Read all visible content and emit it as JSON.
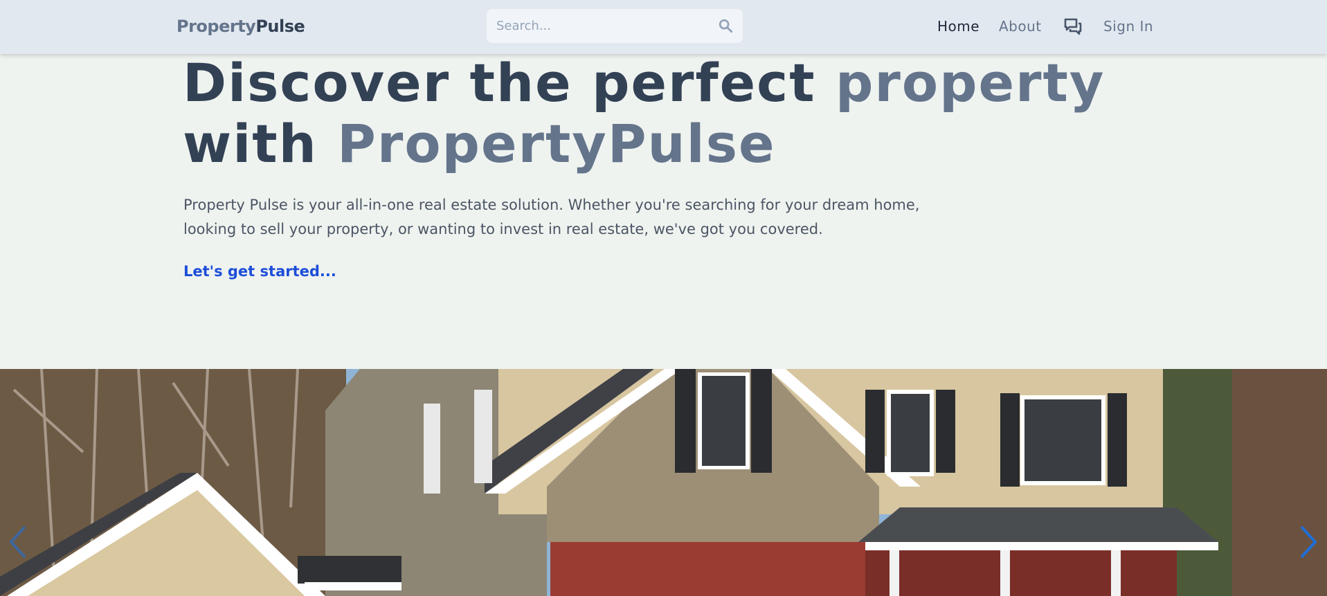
{
  "header": {
    "brand_part1": "Property",
    "brand_part2": "Pulse",
    "search_placeholder": "Search...",
    "nav": {
      "home": "Home",
      "about": "About",
      "sign_in": "Sign In"
    },
    "icons": {
      "search": "search-icon",
      "messages": "chat-icon"
    }
  },
  "hero": {
    "title_part1": "Discover the perfect ",
    "title_part2": "property",
    "title_part3": "with ",
    "title_part4": "PropertyPulse",
    "description": "Property Pulse is your all-in-one real estate solution. Whether you're searching for your dream home, looking to sell your property, or wanting to invest in real estate, we've got you covered.",
    "cta": "Let's get started..."
  },
  "carousel": {
    "prev_icon": "chevron-left-icon",
    "next_icon": "chevron-right-icon"
  },
  "colors": {
    "brand_dark": "#334155",
    "brand_muted": "#64748b",
    "link": "#1d4ed8",
    "carousel_arrow": "#1e6fd9"
  }
}
